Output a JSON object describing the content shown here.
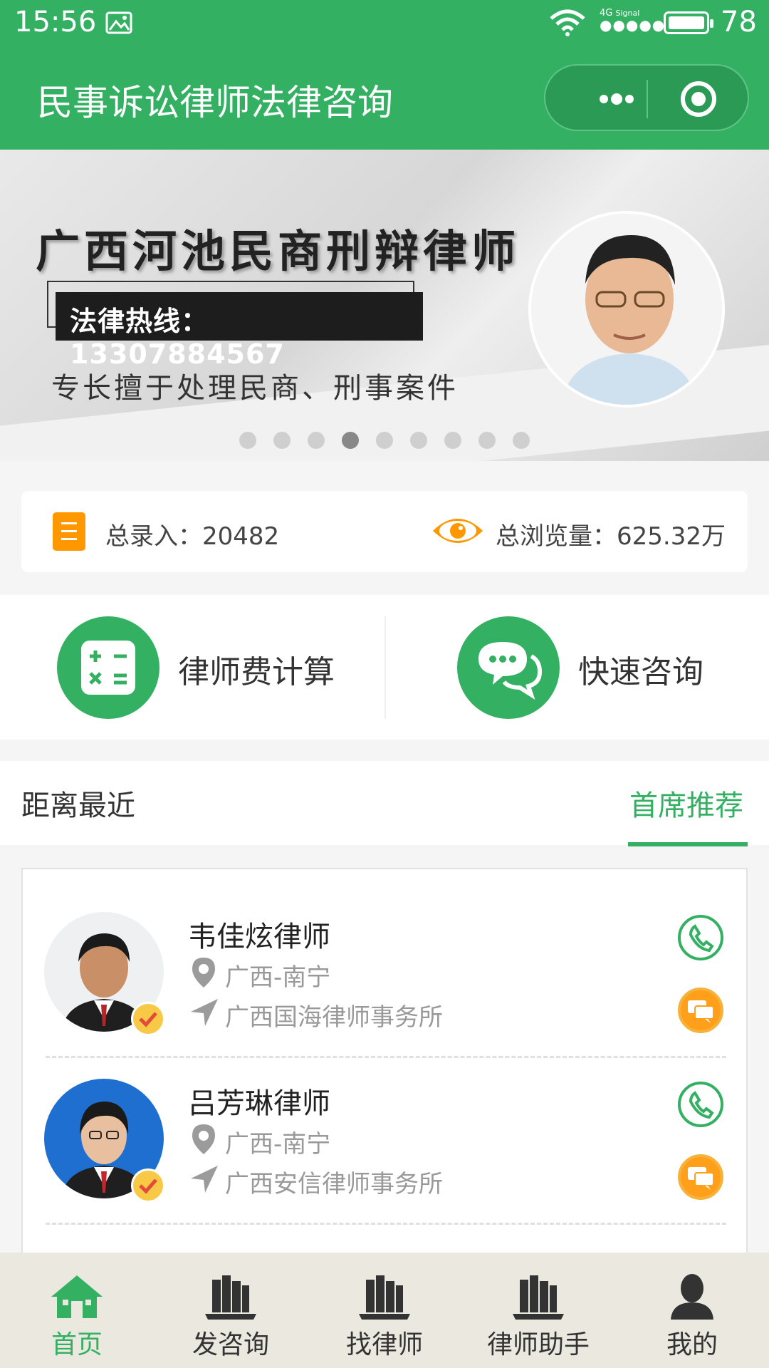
{
  "status_bar": {
    "time": "15:56",
    "network": "4G",
    "signal_label": "Signal",
    "battery": "78"
  },
  "header": {
    "title": "民事诉讼律师法律咨询"
  },
  "banner": {
    "headline": "广西河池民商刑辩律师",
    "hotline": "法律热线：13307884567",
    "specialty": "专长擅于处理民商、刑事案件",
    "slide_count": 9,
    "active_slide": 4
  },
  "stats": {
    "total_entries": "总录入：20482",
    "total_views": "总浏览量：625.32万"
  },
  "quick_actions": [
    {
      "label": "律师费计算",
      "icon": "calculator-icon"
    },
    {
      "label": "快速咨询",
      "icon": "chat-bubbles-icon"
    }
  ],
  "tabs": {
    "nearest": "距离最近",
    "recommended": "首席推荐"
  },
  "lawyers": [
    {
      "name": "韦佳炫律师",
      "location": "广西-南宁",
      "firm": "广西国海律师事务所"
    },
    {
      "name": "吕芳琳律师",
      "location": "广西-南宁",
      "firm": "广西安信律师事务所"
    }
  ],
  "bottom_nav": [
    {
      "label": "首页",
      "icon": "home-icon",
      "active": true
    },
    {
      "label": "发咨询",
      "icon": "books-icon",
      "active": false
    },
    {
      "label": "找律师",
      "icon": "books-icon",
      "active": false
    },
    {
      "label": "律师助手",
      "icon": "books-icon",
      "active": false
    },
    {
      "label": "我的",
      "icon": "user-icon",
      "active": false
    }
  ],
  "colors": {
    "brand_green": "#34b063",
    "accent_orange": "#ff9800",
    "nav_background": "#ebe8e0"
  }
}
